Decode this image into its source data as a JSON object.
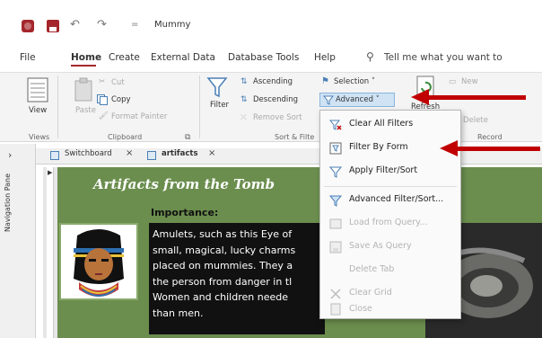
{
  "titlebar": {
    "title": "Mummy",
    "undo_glyph": "↶",
    "redo_glyph": "↷",
    "qa_more_glyph": "="
  },
  "menu": {
    "items": [
      "File",
      "Home",
      "Create",
      "External Data",
      "Database Tools",
      "Help"
    ],
    "active": "Home",
    "tell_me": "Tell me what you want to"
  },
  "ribbon": {
    "views": {
      "view": "View",
      "group": "Views"
    },
    "clipboard": {
      "paste": "Paste",
      "cut": "Cut",
      "copy": "Copy",
      "format_painter": "Format Painter",
      "group": "Clipboard"
    },
    "sort_filter": {
      "filter": "Filter",
      "ascending": "Ascending",
      "descending": "Descending",
      "remove_sort": "Remove Sort",
      "selection": "Selection ˅",
      "advanced": "Advanced ˅",
      "group": "Sort & Filte"
    },
    "records": {
      "refresh": "Refresh",
      "new": "New",
      "delete": "Delete",
      "group": "Record"
    }
  },
  "tabs": [
    {
      "label": "Switchboard",
      "close": "×"
    },
    {
      "label": "artifacts",
      "close": "×"
    }
  ],
  "nav_pane": {
    "label": "Navigation Pane",
    "chevron": "›"
  },
  "form": {
    "title": "Artifacts from the Tomb",
    "importance_label": "Importance:",
    "description_lines": [
      "Amulets, such as this Eye of",
      "small, magical, lucky charms",
      "placed on mummies. They a",
      "the person from danger in tl",
      "Women and children neede",
      "than men."
    ]
  },
  "advanced_menu": {
    "items": [
      {
        "label": "Clear All Filters",
        "enabled": true,
        "icon": "clear-filter-icon"
      },
      {
        "label": "Filter By Form",
        "enabled": true,
        "icon": "filter-by-form-icon"
      },
      {
        "label": "Apply Filter/Sort",
        "enabled": true,
        "icon": "apply-filter-icon"
      },
      {
        "label": "Advanced Filter/Sort...",
        "enabled": true,
        "icon": "advanced-filter-icon"
      },
      {
        "label": "Load from Query...",
        "enabled": false,
        "icon": "load-query-icon"
      },
      {
        "label": "Save As Query",
        "enabled": false,
        "icon": "save-query-icon"
      },
      {
        "label": "Delete Tab",
        "enabled": false,
        "icon": ""
      },
      {
        "label": "Clear Grid",
        "enabled": false,
        "icon": "clear-grid-icon"
      },
      {
        "label": "Close",
        "enabled": false,
        "icon": "close-icon"
      }
    ]
  },
  "colors": {
    "brand": "#a4262c",
    "form_olive": "#6b8e4e",
    "annotation_arrow": "#c00000",
    "highlight": "#cfe3f5"
  }
}
